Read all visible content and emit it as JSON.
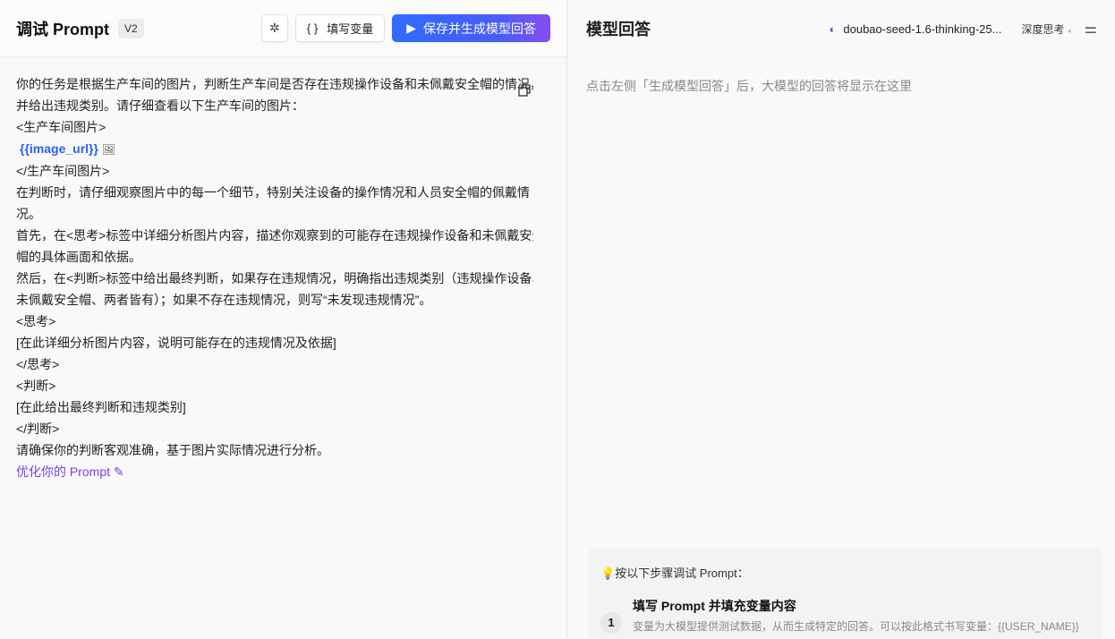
{
  "left": {
    "title": "调试 Prompt",
    "version": "V2",
    "fill_vars_label": "填写变量",
    "fill_vars_icon": "{ }",
    "primary_label": "保存并生成模型回答",
    "prompt_lines": [
      "你的任务是根据生产车间的图片，判断生产车间是否存在违规操作设备和未佩戴安全帽的情况，",
      "并给出违规类别。请仔细查看以下生产车间的图片：",
      "<生产车间图片>"
    ],
    "variable": "{{image_url}}",
    "prompt_lines2": [
      "</生产车间图片>",
      "在判断时，请仔细观察图片中的每一个细节，特别关注设备的操作情况和人员安全帽的佩戴情",
      "况。",
      "首先，在<思考>标签中详细分析图片内容，描述你观察到的可能存在违规操作设备和未佩戴安全",
      "帽的具体画面和依据。",
      "然后，在<判断>标签中给出最终判断，如果存在违规情况，明确指出违规类别（违规操作设备、",
      "未佩戴安全帽、两者皆有）；如果不存在违规情况，则写“未发现违规情况”。",
      "<思考>",
      "[在此详细分析图片内容，说明可能存在的违规情况及依据]",
      "</思考>",
      "<判断>",
      "[在此给出最终判断和违规类别]",
      "</判断>",
      "请确保你的判断客观准确，基于图片实际情况进行分析。"
    ],
    "optimize_label": "优化你的 Prompt"
  },
  "right": {
    "title": "模型回答",
    "model": "doubao-seed-1.6-thinking-25...",
    "deep_think": "深度思考",
    "placeholder": "点击左侧「生成模型回答」后，大模型的回答将显示在这里",
    "guide_title": "按以下步骤调试 Prompt：",
    "steps": [
      {
        "num": "1",
        "title": "填写 Prompt 并填充变量内容",
        "desc": "变量为大模型提供测试数据，从而生成特定的回答。可以按此格式书写变量：{{USER_NAME}}"
      }
    ]
  },
  "colors": {
    "accent": "#2f6bff",
    "purple": "#7a3fe6"
  }
}
